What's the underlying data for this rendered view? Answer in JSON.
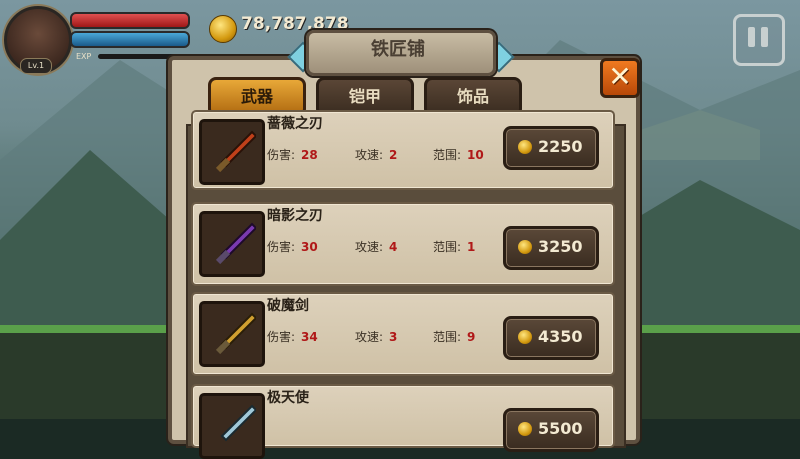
{
  "hud": {
    "level": "Lv.1",
    "exp_label": "EXP",
    "gold": "78,787,878"
  },
  "shop": {
    "title": "铁匠铺",
    "tabs": [
      {
        "label": "武器"
      },
      {
        "label": "铠甲"
      },
      {
        "label": "饰品"
      }
    ],
    "stat_labels": {
      "damage": "伤害:",
      "speed": "攻速:",
      "range": "范围:"
    },
    "items": [
      {
        "name": "蔷薇之刃",
        "damage": "28",
        "speed": "2",
        "range": "10",
        "price": "2250",
        "color": "#c0401a"
      },
      {
        "name": "暗影之刃",
        "damage": "30",
        "speed": "4",
        "range": "1",
        "price": "3250",
        "color": "#7a3ab0"
      },
      {
        "name": "破魔剑",
        "damage": "34",
        "speed": "3",
        "range": "9",
        "price": "4350",
        "color": "#d0a030"
      },
      {
        "name": "极天使",
        "damage": "",
        "speed": "",
        "range": "",
        "price": "5500",
        "color": "#a0c8d8"
      }
    ]
  }
}
